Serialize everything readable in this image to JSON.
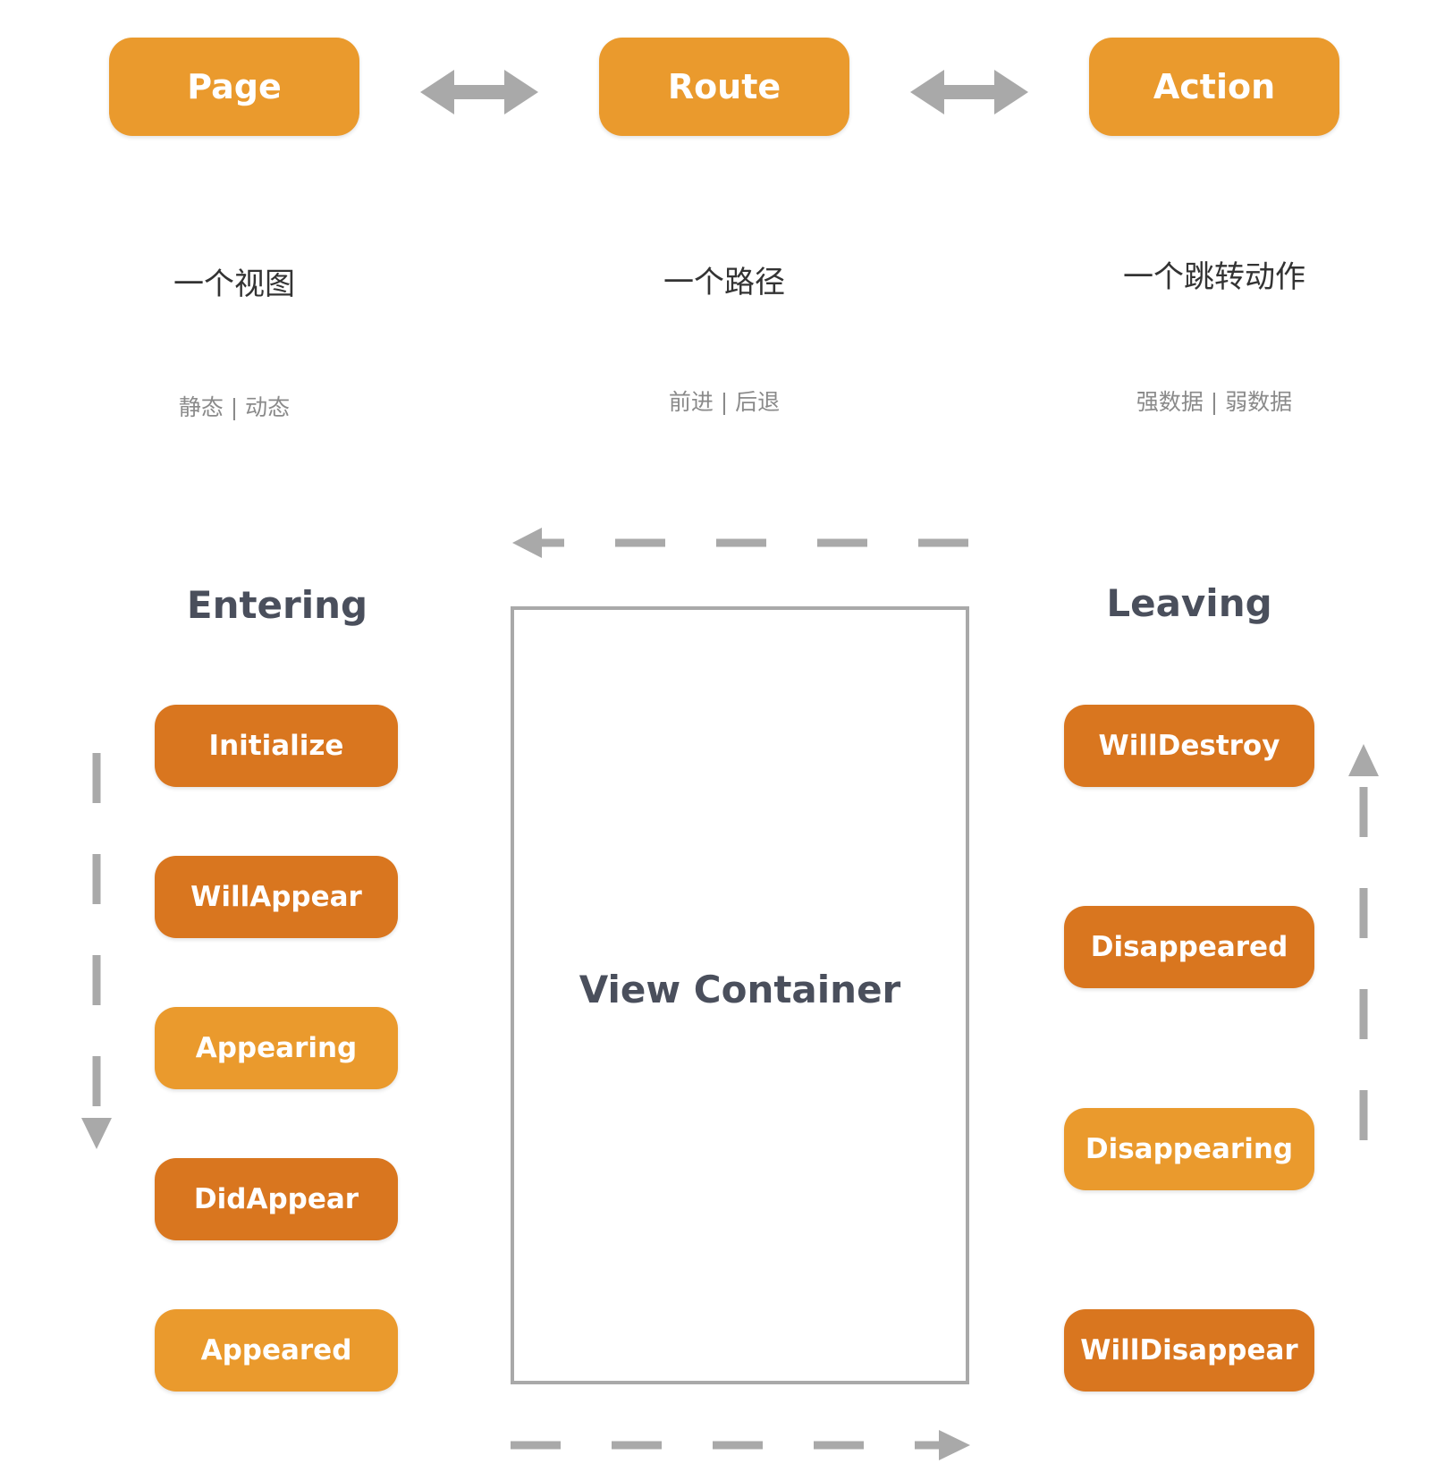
{
  "colors": {
    "light_orange": "#EA9A2D",
    "dark_orange": "#D9761F",
    "arrow_gray": "#A9A9A9",
    "heading_gray": "#4A4F5C"
  },
  "top": {
    "nodes": [
      {
        "label": "Page",
        "desc": "一个视图",
        "sub": "静态 | 动态"
      },
      {
        "label": "Route",
        "desc": "一个路径",
        "sub": "前进 | 后退"
      },
      {
        "label": "Action",
        "desc": "一个跳转动作",
        "sub": "强数据 | 弱数据"
      }
    ]
  },
  "entering": {
    "heading": "Entering",
    "steps": [
      {
        "label": "Initialize",
        "tone": "dark"
      },
      {
        "label": "WillAppear",
        "tone": "dark"
      },
      {
        "label": "Appearing",
        "tone": "light"
      },
      {
        "label": "DidAppear",
        "tone": "dark"
      },
      {
        "label": "Appeared",
        "tone": "light"
      }
    ]
  },
  "leaving": {
    "heading": "Leaving",
    "steps": [
      {
        "label": "WillDestroy",
        "tone": "dark"
      },
      {
        "label": "Disappeared",
        "tone": "dark"
      },
      {
        "label": "Disappearing",
        "tone": "light"
      },
      {
        "label": "WillDisappear",
        "tone": "dark"
      }
    ]
  },
  "container": {
    "label": "View Container"
  }
}
